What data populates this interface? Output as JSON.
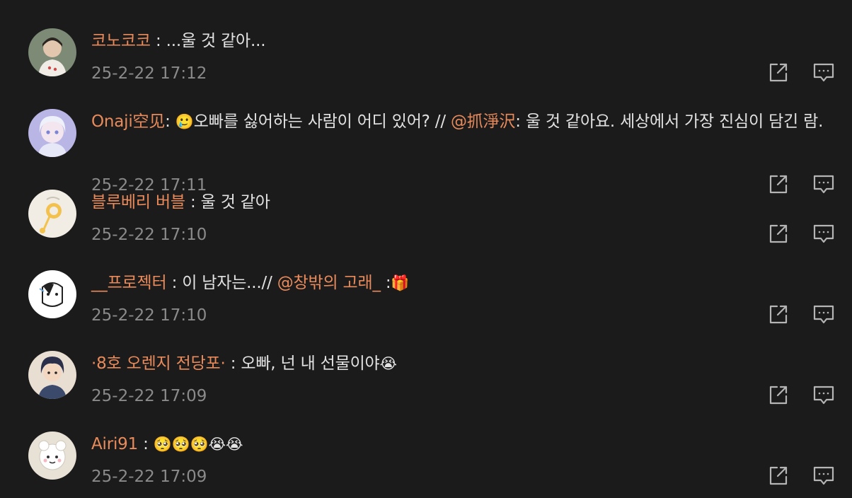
{
  "comments": [
    {
      "username": "코노코코",
      "separator": " : ",
      "text": "...울 것 같아...",
      "time": "25-2-22 17:12"
    },
    {
      "username": "Onaji空见",
      "separator": ": ",
      "emoji": "🥲",
      "text": "오빠를 싫어하는 사람이 어디 있어? // ",
      "mention": "@抓淨沢",
      "text2": ": 울 것 같아요. 세상에서 가장 진심이 담긴 ",
      "text3": "람.",
      "time": "25-2-22 17:11"
    },
    {
      "username": "블루베리 버블",
      "separator": " : ",
      "text": "울 것 같아",
      "time": "25-2-22 17:10"
    },
    {
      "username": "__프로젝터",
      "separator": " : ",
      "text": "이 남자는...// ",
      "mention": "@창밖의 고래_",
      "text2": " :",
      "emoji": "🎁",
      "time": "25-2-22 17:10"
    },
    {
      "username": "·8호 오렌지 전당포·",
      "separator": " : ",
      "text": "오빠, 넌 내 선물이야",
      "emoji": "😭",
      "time": "25-2-22 17:09"
    },
    {
      "username": "Airi91",
      "separator": " : ",
      "emoji": "🥺🥺🥺😭😭",
      "time": "25-2-22 17:09"
    }
  ],
  "icons": {
    "share": "share-icon",
    "reply": "reply-comment-icon"
  },
  "colors": {
    "background": "#1b1b1b",
    "username": "#e98a5b",
    "text": "#e2e2e2",
    "time": "#8a8a8a",
    "icon": "#b5b5b5"
  }
}
